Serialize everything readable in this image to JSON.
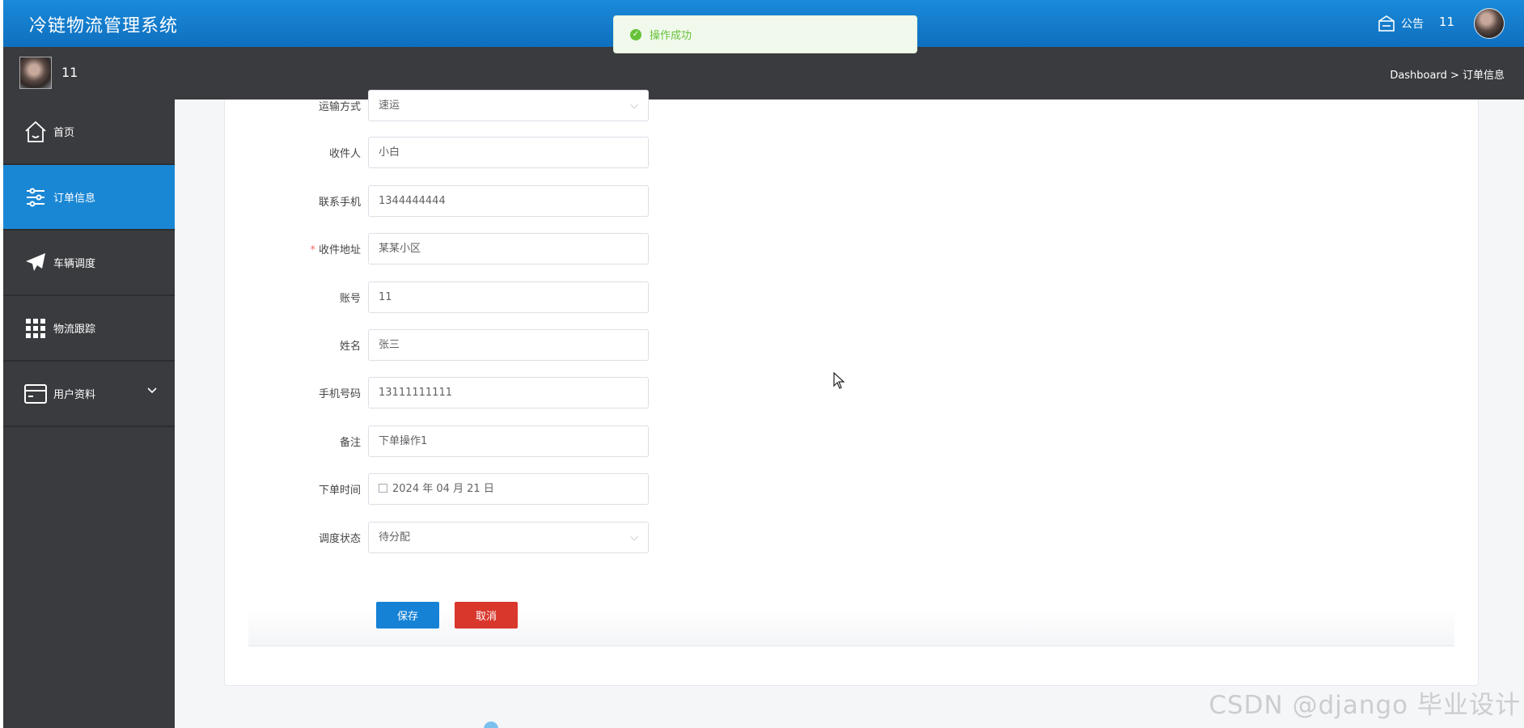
{
  "header": {
    "title": "冷链物流管理系统",
    "notice_label": "公告",
    "username": "11"
  },
  "toast": {
    "message": "操作成功"
  },
  "subbar": {
    "username": "11",
    "breadcrumb": "Dashboard > 订单信息"
  },
  "sidebar": {
    "items": [
      {
        "label": "首页",
        "icon": "home-icon"
      },
      {
        "label": "订单信息",
        "icon": "sliders-icon",
        "active": true
      },
      {
        "label": "车辆调度",
        "icon": "paper-plane-icon"
      },
      {
        "label": "物流跟踪",
        "icon": "grid-icon"
      },
      {
        "label": "用户资料",
        "icon": "card-icon",
        "expandable": true
      }
    ]
  },
  "form": {
    "fields": [
      {
        "label": "运输方式",
        "value": "速运",
        "type": "select"
      },
      {
        "label": "收件人",
        "value": "小白"
      },
      {
        "label": "联系手机",
        "value": "1344444444"
      },
      {
        "label": "收件地址",
        "value": "某某小区",
        "required": true
      },
      {
        "label": "账号",
        "value": "11"
      },
      {
        "label": "姓名",
        "value": "张三"
      },
      {
        "label": "手机号码",
        "value": "13111111111"
      },
      {
        "label": "备注",
        "value": "下单操作1"
      },
      {
        "label": "下单时间",
        "value": "2024 年 04 月 21 日",
        "type": "date"
      },
      {
        "label": "调度状态",
        "value": "待分配",
        "type": "select"
      }
    ],
    "save_label": "保存",
    "cancel_label": "取消"
  },
  "watermark": "CSDN @django 毕业设计",
  "colors": {
    "header_blue": "#1a8ad9",
    "active_blue": "#1a87d5",
    "dark_bar": "#3a3b3f",
    "success_green": "#67c23a",
    "cancel_red": "#d9362c"
  }
}
